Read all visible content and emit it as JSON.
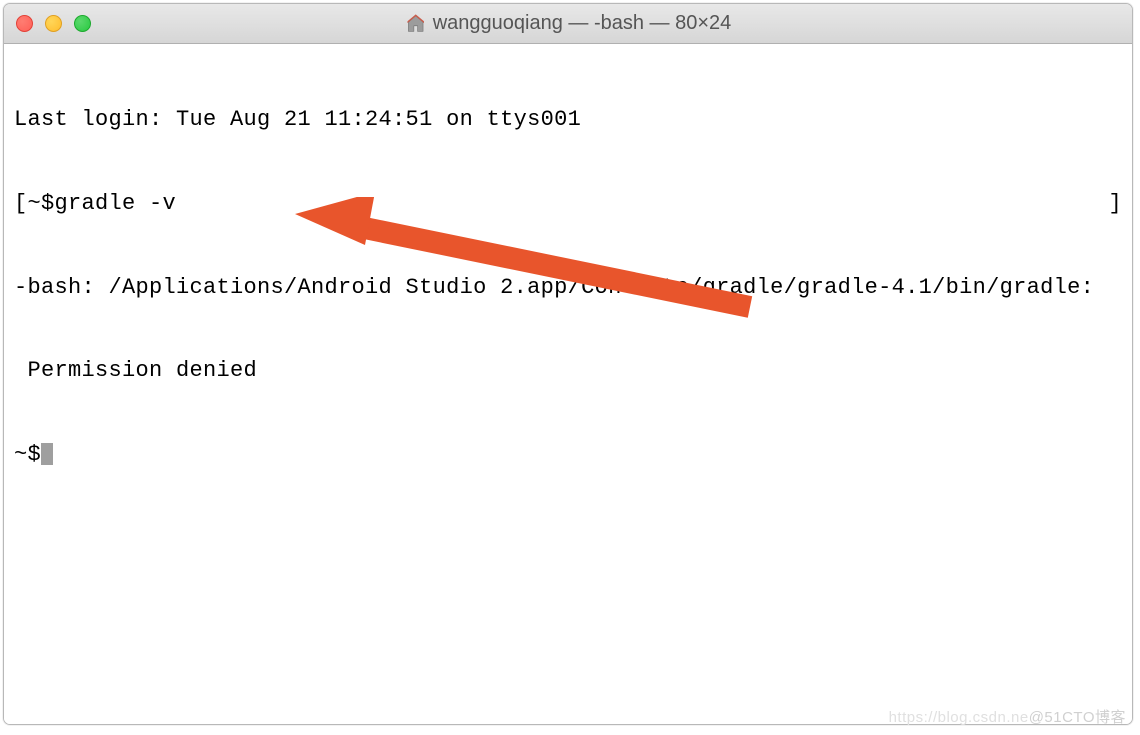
{
  "titlebar": {
    "title": "wangguoqiang — -bash — 80×24"
  },
  "terminal": {
    "line1": "Last login: Tue Aug 21 11:24:51 on ttys001",
    "line2_prefix": "[",
    "line2_prompt": "~$",
    "line2_command": "gradle -v",
    "line2_suffix": "]",
    "line3": "-bash: /Applications/Android Studio 2.app/Contents/gradle/gradle-4.1/bin/gradle:",
    "line4": " Permission denied",
    "line5_prompt": "~$"
  },
  "watermark": {
    "text1": "https://blog.csdn.ne",
    "text2": "@51CTO博客"
  },
  "colors": {
    "arrow": "#e8552c"
  }
}
